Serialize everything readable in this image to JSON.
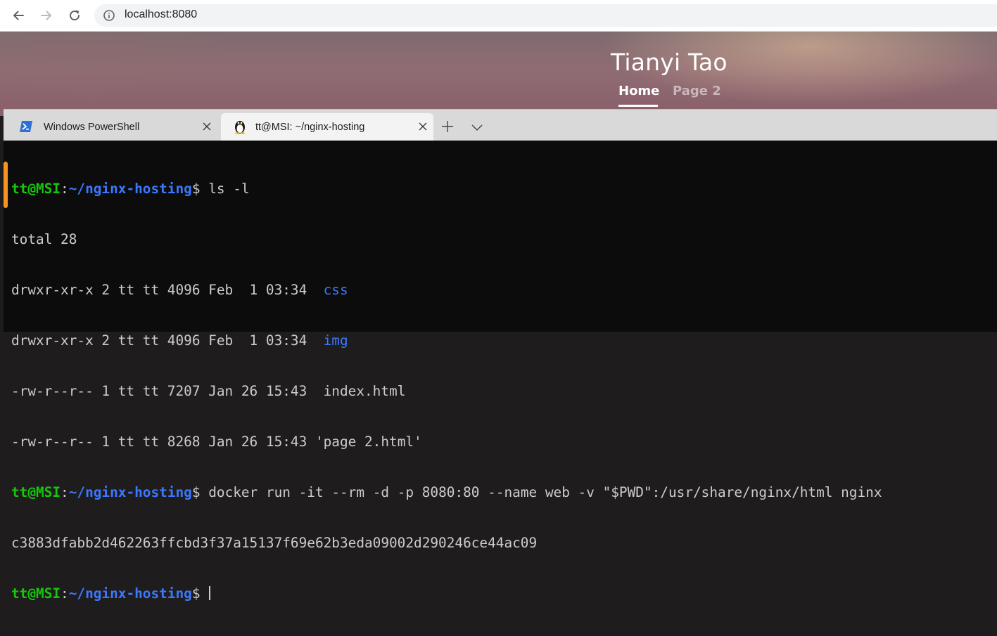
{
  "browser": {
    "url": "localhost:8080",
    "icons": {
      "back": "arrow-left-icon",
      "forward": "arrow-right-icon",
      "reload": "reload-icon",
      "info": "info-icon"
    }
  },
  "site": {
    "title": "Tianyi Tao",
    "nav": {
      "home": "Home",
      "page2": "Page 2"
    }
  },
  "terminal": {
    "tabs": [
      {
        "label": "Windows PowerShell",
        "icon": "powershell-icon",
        "active": false
      },
      {
        "label": "tt@MSI: ~/nginx-hosting",
        "icon": "linux-penguin-icon",
        "active": true
      }
    ],
    "prompt": {
      "user": "tt@MSI",
      "sep": ":",
      "path": "~/nginx-hosting",
      "symbol": "$ "
    },
    "cmd1": "ls -l",
    "ls_output": {
      "total": "total 28",
      "rows": [
        {
          "meta": "drwxr-xr-x 2 tt tt 4096 Feb  1 03:34  ",
          "name": "css"
        },
        {
          "meta": "drwxr-xr-x 2 tt tt 4096 Feb  1 03:34  ",
          "name": "img"
        },
        {
          "meta": "-rw-r--r-- 1 tt tt 7207 Jan 26 15:43  ",
          "name": "index.html"
        },
        {
          "meta": "-rw-r--r-- 1 tt tt 8268 Jan 26 15:43 ",
          "name": "'page 2.html'"
        }
      ]
    },
    "cmd2": "docker run -it --rm -d -p 8080:80 --name web -v \"$PWD\":/usr/share/nginx/html nginx",
    "container_id": "c3883dfabb2d462263ffcbd3f37a15137f69e62b3eda09002d290246ce44ac09",
    "colors": {
      "user": "#16c60c",
      "path": "#3b78ff",
      "text": "#cccccc",
      "background": "#0c0c0c"
    }
  }
}
